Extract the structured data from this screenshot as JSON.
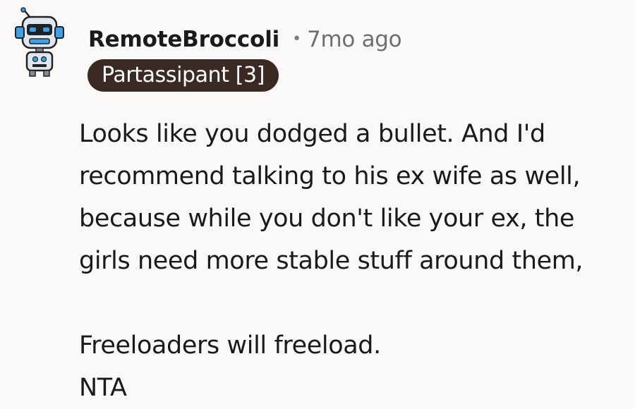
{
  "comment": {
    "username": "RemoteBroccoli",
    "separator": "•",
    "timestamp": "7mo ago",
    "flair": "Partassipant [3]",
    "avatar_icon": "robot-avatar-icon",
    "paragraphs": [
      "Looks like you dodged a bullet. And I'd\nrecommend talking to his ex wife as well,\nbecause while you don't like your ex, the\ngirls need more stable stuff around them,",
      "Freeloaders will freeload.\nNTA"
    ]
  },
  "colors": {
    "background": "#fbf9f8",
    "text": "#1a1a1b",
    "meta": "#6f6f6f",
    "flair_bg": "#3b2a24",
    "flair_text": "#ffffff",
    "avatar_accent": "#3aa0e8"
  }
}
